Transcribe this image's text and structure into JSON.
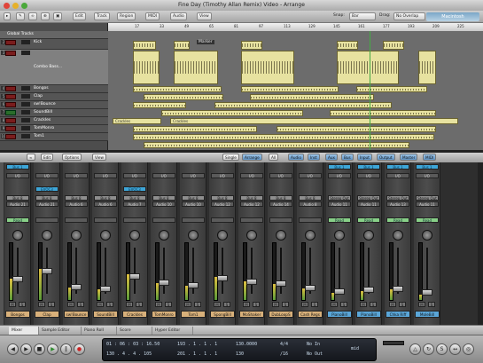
{
  "window": {
    "title": "Fine Day (Timothy Allan Remix) Video - Arrange"
  },
  "toolbar": {
    "buttons": [
      "Edit",
      "Track",
      "Region",
      "MIDI",
      "Audio",
      "View"
    ],
    "snap_label": "Snap:",
    "snap_value": "Bar",
    "drag_label": "Drag:",
    "drag_value": "No Overlap",
    "logo": "Macintosh"
  },
  "tracks": [
    {
      "num": "1",
      "name": "Global Tracks"
    },
    {
      "num": "2",
      "name": "Kick"
    },
    {
      "num": "3",
      "name": "Combo Bass..."
    },
    {
      "num": "4",
      "name": "Bongos"
    },
    {
      "num": "5",
      "name": "Clap"
    },
    {
      "num": "6",
      "name": "sw!Bounce"
    },
    {
      "num": "7",
      "name": "SoundBill"
    },
    {
      "num": "8",
      "name": "Crackles"
    },
    {
      "num": "9",
      "name": "TomMonro"
    },
    {
      "num": "10",
      "name": "Tom1"
    }
  ],
  "ruler": {
    "marks": [
      "17",
      "33",
      "49",
      "65",
      "81",
      "97",
      "113",
      "129",
      "145",
      "161",
      "177",
      "193",
      "209",
      "225"
    ]
  },
  "regions": {
    "crackles_label": "Crackles"
  },
  "hint": "Marker",
  "mixer_toolbar": {
    "buttons": [
      "Edit",
      "Options",
      "View"
    ],
    "filters": [
      "Single",
      "Arrange",
      "All",
      "Audio",
      "Inst",
      "Aux",
      "Bus",
      "Input",
      "Output",
      "Master",
      "MIDI"
    ]
  },
  "strips": [
    {
      "name": "Bongos",
      "top": "Bus 1",
      "io": "I/O",
      "bus": "Bus 8",
      "audio": "Audio 21",
      "status": "Read",
      "level": 0.38,
      "color": "orange"
    },
    {
      "name": "Clap",
      "top": "",
      "io": "I/O",
      "bus": "Bus 8",
      "audio": "Audio 21",
      "status": "",
      "level": 0.55,
      "color": "orange",
      "insert": "EVOC3"
    },
    {
      "name": "sw!Bounce",
      "top": "",
      "io": "I/O",
      "bus": "Bus 8",
      "audio": "Audio 6",
      "status": "",
      "level": 0.22,
      "color": "orange"
    },
    {
      "name": "SoundBill",
      "top": "",
      "io": "I/O",
      "bus": "Bus 8",
      "audio": "Audio 6",
      "status": "",
      "level": 0.18,
      "color": "orange"
    },
    {
      "name": "Crackles",
      "top": "",
      "io": "I/O",
      "bus": "Bus 8",
      "audio": "Audio 7",
      "status": "",
      "level": 0.45,
      "color": "orange",
      "insert": "EVOC3"
    },
    {
      "name": "TomMonro",
      "top": "",
      "io": "I/O",
      "bus": "Bus 8",
      "audio": "Audio 10",
      "status": "",
      "level": 0.3,
      "color": "orange"
    },
    {
      "name": "Tom1",
      "top": "",
      "io": "I/O",
      "bus": "Bus 8",
      "audio": "Audio 10",
      "status": "",
      "level": 0.25,
      "color": "orange"
    },
    {
      "name": "SpongBill",
      "top": "",
      "io": "I/O",
      "bus": "Bus 8",
      "audio": "Audio 12",
      "status": "",
      "level": 0.4,
      "color": "orange"
    },
    {
      "name": "MoShaker",
      "top": "",
      "io": "I/O",
      "bus": "Bus 8",
      "audio": "Audio 12",
      "status": "",
      "level": 0.33,
      "color": "orange"
    },
    {
      "name": "DubLoopS",
      "top": "",
      "io": "I/O",
      "bus": "Bus 8",
      "audio": "Audio 14",
      "status": "",
      "level": 0.28,
      "color": "orange"
    },
    {
      "name": "Cash Regs",
      "top": "",
      "io": "I/O",
      "bus": "Bus 8",
      "audio": "Audio 8",
      "status": "",
      "level": 0.2,
      "color": "orange"
    },
    {
      "name": "PianoBill",
      "top": "Bus 1",
      "io": "I/O",
      "bus": "Stereo Out",
      "audio": "Audio 11",
      "status": "Read",
      "level": 0.12,
      "color": "blue"
    },
    {
      "name": "PianoBill",
      "top": "Bus 1",
      "io": "I/O",
      "bus": "Stereo Out",
      "audio": "Audio 11",
      "status": "Read",
      "level": 0.15,
      "color": "blue"
    },
    {
      "name": "Chka Riff",
      "top": "Bus 1",
      "io": "I/O",
      "bus": "Stereo Out",
      "audio": "Audio 13",
      "status": "Read",
      "level": 0.18,
      "color": "blue"
    },
    {
      "name": "MoleBill",
      "top": "Bus 1",
      "io": "I/O",
      "bus": "Stereo Out",
      "audio": "Audio 11",
      "status": "Read",
      "level": 0.1,
      "color": "blue"
    }
  ],
  "bottom_tabs": [
    "Mixer",
    "Sample Editor",
    "Piano Roll",
    "Score",
    "Hyper Editor"
  ],
  "transport": {
    "smpte": "01 : 06 : 03 : 16.50",
    "bars": "130 . 4 . 4 . 105",
    "bars2": "193 . 1 . 1 . 1",
    "bars3": "201 . 1 . 1 . 1",
    "tempo": "130.0000",
    "tempo2": "130",
    "sig": "4/4",
    "div": "/16",
    "in": "No In",
    "out": "No Out",
    "mode": "mid"
  }
}
